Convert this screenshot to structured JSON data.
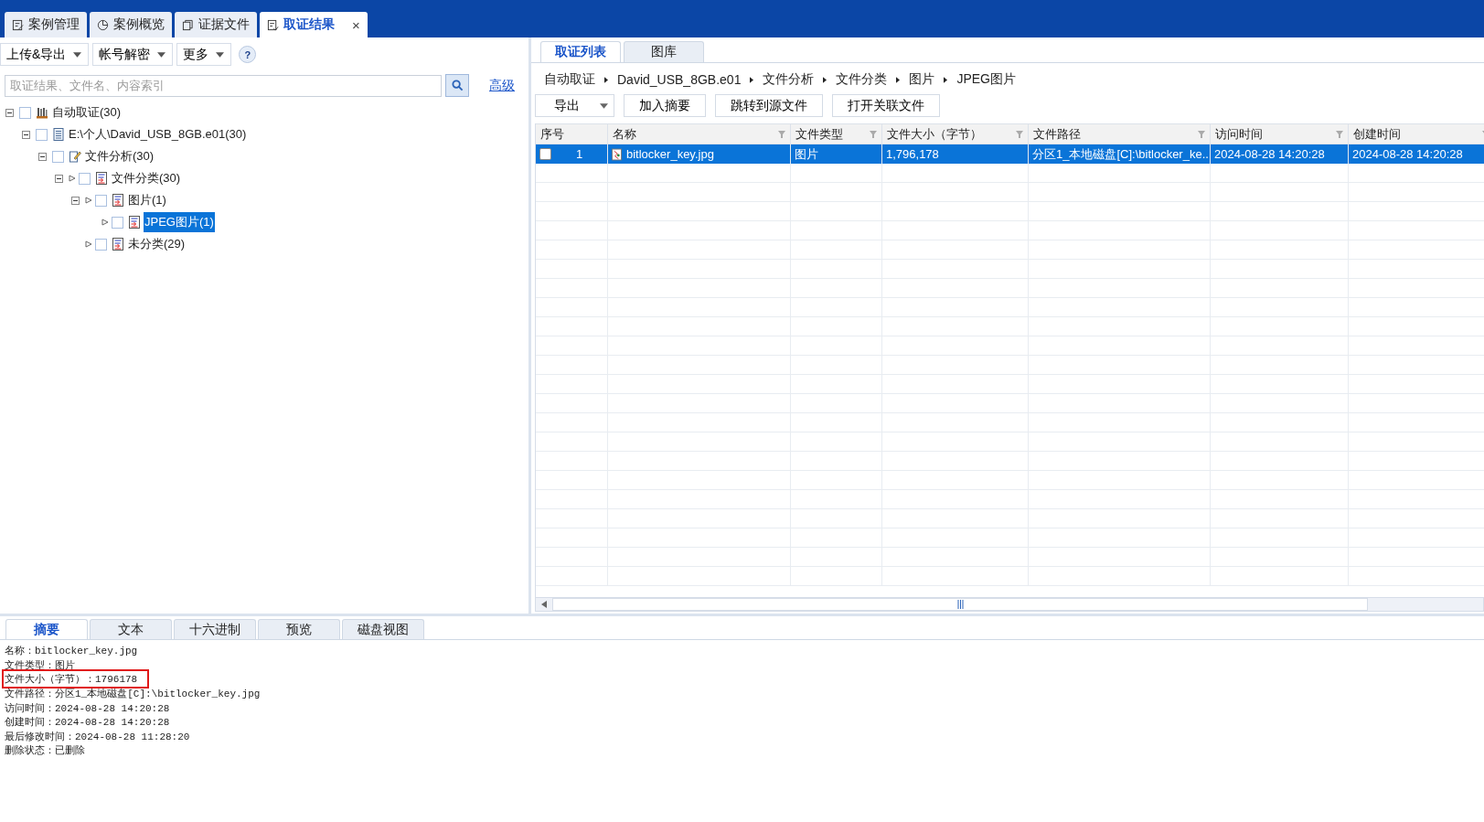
{
  "top_tabs": [
    {
      "label": "案例管理",
      "kind": "edit",
      "selected": false
    },
    {
      "label": "案例概览",
      "kind": "pie",
      "selected": false
    },
    {
      "label": "证据文件",
      "kind": "copy",
      "selected": false
    },
    {
      "label": "取证结果",
      "kind": "list",
      "selected": true,
      "close": "×"
    }
  ],
  "toolbar": {
    "dropdowns": [
      "上传&导出",
      "帐号解密",
      "更多"
    ],
    "help": "?"
  },
  "search": {
    "placeholder": "取证结果、文件名、内容索引",
    "advanced": "高级"
  },
  "tree": [
    {
      "label": "自动取证(30)",
      "kind": "root",
      "checked": false,
      "expanded": true,
      "selected": false,
      "children": [
        {
          "label": "E:\\个人\\David_USB_8GB.e01(30)",
          "kind": "image",
          "checked": false,
          "expanded": true,
          "selected": false,
          "children": [
            {
              "label": "文件分析(30)",
              "kind": "analysis",
              "checked": false,
              "expanded": true,
              "selected": false,
              "children": [
                {
                  "label": "文件分类(30)",
                  "kind": "category",
                  "checked": false,
                  "expanded": true,
                  "selected": false,
                  "children": [
                    {
                      "label": "图片(1)",
                      "kind": "category",
                      "checked": false,
                      "expanded": true,
                      "selected": false,
                      "children": [
                        {
                          "label": "JPEG图片(1)",
                          "kind": "category",
                          "checked": false,
                          "selected": true
                        }
                      ]
                    },
                    {
                      "label": "未分类(29)",
                      "kind": "category",
                      "checked": false,
                      "selected": false
                    }
                  ]
                }
              ]
            }
          ]
        }
      ]
    }
  ],
  "right_tabs": [
    {
      "label": "取证列表",
      "selected": true
    },
    {
      "label": "图库",
      "selected": false
    }
  ],
  "breadcrumb": [
    "自动取证",
    "David_USB_8GB.e01",
    "文件分析",
    "文件分类",
    "图片",
    "JPEG图片"
  ],
  "actions": [
    {
      "label": "导出",
      "kind": "dropdown"
    },
    {
      "label": "加入摘要",
      "kind": "button"
    },
    {
      "label": "跳转到源文件",
      "kind": "button"
    },
    {
      "label": "打开关联文件",
      "kind": "button"
    }
  ],
  "table": {
    "columns": [
      {
        "label": "序号",
        "filter": false
      },
      {
        "label": "名称",
        "filter": true
      },
      {
        "label": "文件类型",
        "filter": true
      },
      {
        "label": "文件大小（字节）",
        "filter": true
      },
      {
        "label": "文件路径",
        "filter": true
      },
      {
        "label": "访问时间",
        "filter": true
      },
      {
        "label": "创建时间",
        "filter": true
      }
    ],
    "rows": [
      {
        "checked": false,
        "selected": true,
        "cells": [
          "1",
          "bitlocker_key.jpg",
          "图片",
          "1,796,178",
          "分区1_本地磁盘[C]:\\bitlocker_ke...",
          "2024-08-28 14:20:28",
          "2024-08-28 14:20:28"
        ]
      }
    ]
  },
  "bottom_tabs": [
    {
      "label": "摘要",
      "selected": true
    },
    {
      "label": "文本",
      "selected": false
    },
    {
      "label": "十六进制",
      "selected": false
    },
    {
      "label": "预览",
      "selected": false
    },
    {
      "label": "磁盘视图",
      "selected": false
    }
  ],
  "summary": [
    {
      "text": "名称：bitlocker_key.jpg",
      "highlighted": false
    },
    {
      "text": "文件类型：图片",
      "highlighted": false
    },
    {
      "text": "文件大小（字节）：1796178",
      "highlighted": true
    },
    {
      "text": "文件路径：分区1_本地磁盘[C]:\\bitlocker_key.jpg",
      "highlighted": false
    },
    {
      "text": "访问时间：2024-08-28 14:20:28",
      "highlighted": false
    },
    {
      "text": "创建时间：2024-08-28 14:20:28",
      "highlighted": false
    },
    {
      "text": "最后修改时间：2024-08-28 11:28:20",
      "highlighted": false
    },
    {
      "text": "删除状态：已删除",
      "highlighted": false
    }
  ]
}
